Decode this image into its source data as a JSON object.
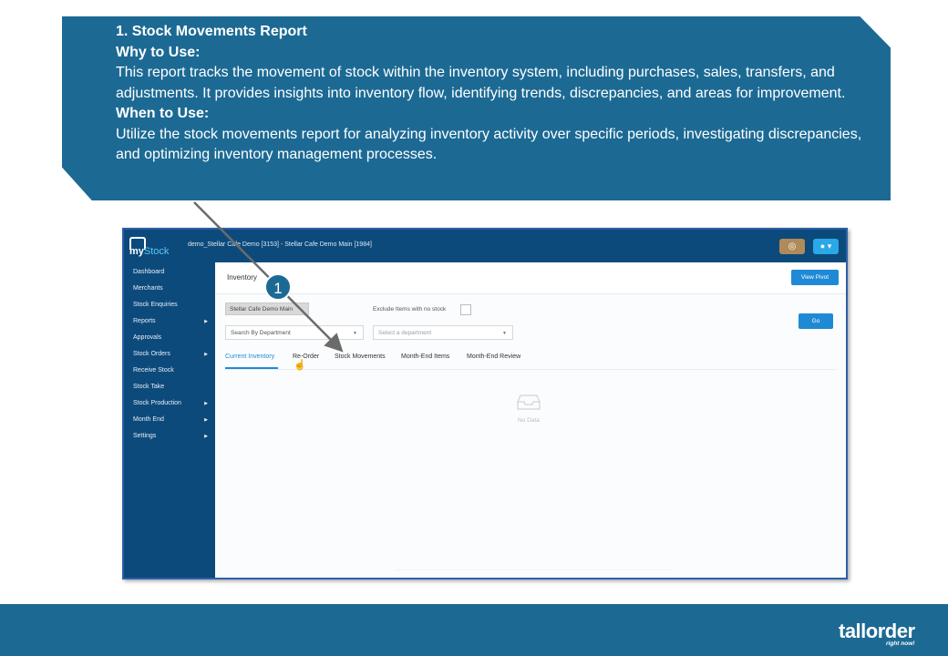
{
  "banner": {
    "heading": "1. Stock Movements Report",
    "why_label": "Why to Use:",
    "why_text": "This report tracks the movement of stock within the inventory system, including purchases, sales, transfers, and adjustments. It provides insights into inventory flow, identifying trends, discrepancies, and areas for improvement.",
    "when_label": "When to Use:",
    "when_text": "Utilize the stock movements report for analyzing inventory activity over specific periods, investigating discrepancies, and optimizing inventory management processes."
  },
  "app": {
    "logo_prefix": "my",
    "logo_suffix": "Stock",
    "breadcrumb": "demo_Stellar Cafe Demo [3153] - Stellar Cafe Demo Main [1984]",
    "globe_icon": "globe-icon",
    "user_icon": "user-icon"
  },
  "sidebar": {
    "items": [
      {
        "label": "Dashboard",
        "has_submenu": false
      },
      {
        "label": "Merchants",
        "has_submenu": false
      },
      {
        "label": "Stock Enquiries",
        "has_submenu": false
      },
      {
        "label": "Reports",
        "has_submenu": true
      },
      {
        "label": "Approvals",
        "has_submenu": false
      },
      {
        "label": "Stock Orders",
        "has_submenu": true
      },
      {
        "label": "Receive Stock",
        "has_submenu": false
      },
      {
        "label": "Stock Take",
        "has_submenu": false
      },
      {
        "label": "Stock Production",
        "has_submenu": true
      },
      {
        "label": "Month End",
        "has_submenu": true
      },
      {
        "label": "Settings",
        "has_submenu": true
      }
    ]
  },
  "main": {
    "title": "Inventory",
    "view_pivot_label": "View Pivot",
    "location_value": "Stellar Cafe Demo Main",
    "exclude_label": "Exclude Items with no stock",
    "search_by_value": "Search By Department",
    "department_placeholder": "Select a department",
    "go_label": "Go",
    "tabs": [
      {
        "label": "Current Inventory",
        "active": true
      },
      {
        "label": "Re-Order",
        "active": false
      },
      {
        "label": "Stock Movements",
        "active": false
      },
      {
        "label": "Month-End Items",
        "active": false
      },
      {
        "label": "Month-End Review",
        "active": false
      }
    ],
    "empty_text": "No Data"
  },
  "annotation": {
    "step_number": "1"
  },
  "footer": {
    "brand_a": "tall",
    "brand_b": "order",
    "tagline": "right now!"
  },
  "colors": {
    "banner": "#1c6a94",
    "app_nav": "#0d4a7c",
    "accent": "#1e8ad6"
  }
}
